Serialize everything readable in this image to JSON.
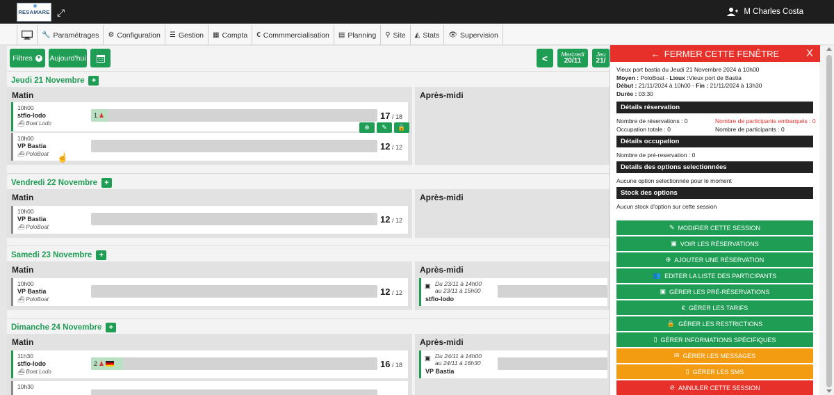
{
  "header": {
    "logo_text": "RESAMARE",
    "user_name": "M Charles Costa"
  },
  "menu": [
    {
      "label": ""
    },
    {
      "label": "Paramétrages"
    },
    {
      "label": "Configuration"
    },
    {
      "label": "Gestion"
    },
    {
      "label": "Compta"
    },
    {
      "label": "Commmercialisation"
    },
    {
      "label": "Planning"
    },
    {
      "label": "Site"
    },
    {
      "label": "Stats"
    },
    {
      "label": "Supervision"
    }
  ],
  "toolbar": {
    "filters_label": "Filtres",
    "today_label": "Aujourd'hui",
    "nav_prev_label": "<",
    "day1_name": "Mercredi",
    "day1_date": "20/11",
    "day2_name": "Jeu",
    "day2_date": "21/"
  },
  "days": [
    {
      "title": "Jeudi 21 Novembre",
      "morning_label": "Matin",
      "afternoon_label": "Après-midi",
      "sessions": [
        {
          "time": "10h00",
          "name": "stflo-lodo",
          "boat": "Boat Lodo",
          "booked": "1",
          "count": "17",
          "capacity": "/ 18"
        },
        {
          "time": "10h00",
          "name": "VP Bastia",
          "boat": "PoloBoat",
          "booked": "",
          "count": "12",
          "capacity": "/ 12"
        }
      ]
    },
    {
      "title": "Vendredi 22 Novembre",
      "morning_label": "Matin",
      "afternoon_label": "Après-midi",
      "sessions": [
        {
          "time": "10h00",
          "name": "VP Bastia",
          "boat": "PoloBoat",
          "booked": "",
          "count": "12",
          "capacity": "/ 12"
        }
      ]
    },
    {
      "title": "Samedi 23 Novembre",
      "morning_label": "Matin",
      "afternoon_label": "Après-midi",
      "sessions": [
        {
          "time": "10h00",
          "name": "VP Bastia",
          "boat": "PoloBoat",
          "booked": "",
          "count": "12",
          "capacity": "/ 12"
        }
      ],
      "pm": {
        "line1": "Du 23/11 à 14h00",
        "line2": "au 23/11 à 15h00",
        "name": "stflo-lodo"
      }
    },
    {
      "title": "Dimanche 24 Novembre",
      "morning_label": "Matin",
      "afternoon_label": "Après-midi",
      "sessions": [
        {
          "time": "11h30",
          "name": "stflo-lodo",
          "boat": "Boat Lodo",
          "booked": "2",
          "count": "16",
          "capacity": "/ 18"
        },
        {
          "time": "10h30",
          "name": "",
          "boat": "",
          "booked": "",
          "count": "",
          "capacity": ""
        }
      ],
      "pm": {
        "line1": "Du 24/11 à 14h00",
        "line2": "au 24/11 à 16h30",
        "name": "VP Bastia"
      }
    }
  ],
  "panel": {
    "close_label": "FERMER CETTE FENÊTRE",
    "close_x": "X",
    "title": "Vieux port bastia du Jeudi 21 Novembre 2024 à 10h00",
    "moyen_key": "Moyen :",
    "moyen_val": " PoloBoat - ",
    "lieux_key": "Lieux :",
    "lieux_val": "Vieux port de Bastia",
    "debut_key": "Début :",
    "debut_val": " 21/11/2024 à 10h00 - ",
    "fin_key": "Fin :",
    "fin_val": " 21/11/2024 à 13h30",
    "duree_key": "Durée :",
    "duree_val": " 03:30",
    "sec_reservation": "Détails réservation",
    "nb_reservations": "Nombre de réservations : 0",
    "nb_embarques": "Nombre de participants embarqués : 0",
    "occupation_totale": "Occupation totale : 0",
    "nb_participants": "Nombre de participants : 0",
    "sec_occupation": "Détails occupation",
    "nb_prereservation": "Nombre de pré-reservation : 0",
    "sec_options": "Details des options selectionnées",
    "no_option": "Aucune option selectionnée pour le moment",
    "sec_stock": "Stock des options",
    "no_stock": "Aucun stock d'option sur cette session",
    "actions": [
      {
        "label": "Modifier cette session",
        "icon": "edit-icon",
        "color": "green"
      },
      {
        "label": "Voir les réservations",
        "icon": "calendar-icon",
        "color": "green"
      },
      {
        "label": "Ajouter une réservation",
        "icon": "plus-circle-icon",
        "color": "green"
      },
      {
        "label": "Editer la liste des participants",
        "icon": "users-icon",
        "color": "green"
      },
      {
        "label": "Gérer les pré-réservations",
        "icon": "calendar-check-icon",
        "color": "green"
      },
      {
        "label": "Gérer les tarifs",
        "icon": "euro-icon",
        "color": "green"
      },
      {
        "label": "Gérer les restrictions",
        "icon": "lock-icon",
        "color": "green"
      },
      {
        "label": "Gérer informations spécifiques",
        "icon": "file-icon",
        "color": "green"
      },
      {
        "label": "Gérer les messages",
        "icon": "envelope-icon",
        "color": "orange"
      },
      {
        "label": "Gérer les SMS",
        "icon": "mobile-icon",
        "color": "orange"
      },
      {
        "label": "Annuler cette session",
        "icon": "ban-icon",
        "color": "red"
      }
    ]
  },
  "colors": {
    "green": "#1f9d55",
    "red": "#e8302a",
    "orange": "#f39c12",
    "dark": "#1e1e1e"
  }
}
